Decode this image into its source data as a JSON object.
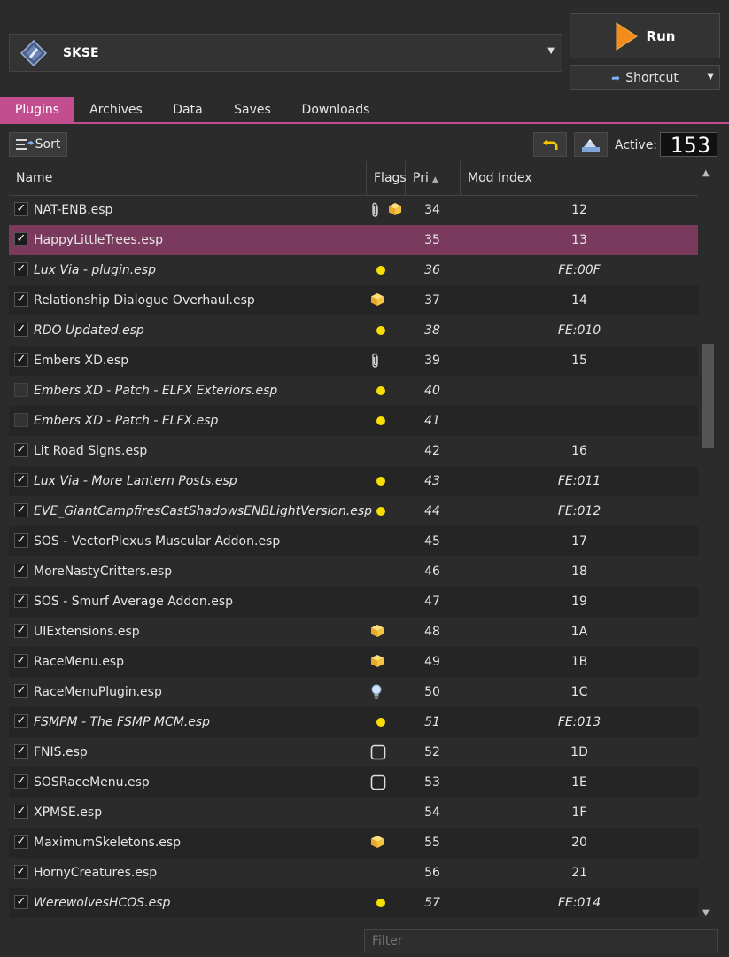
{
  "executable": {
    "selected": "SKSE"
  },
  "run": {
    "label": "Run"
  },
  "shortcut": {
    "label": "Shortcut"
  },
  "tabs": [
    "Plugins",
    "Archives",
    "Data",
    "Saves",
    "Downloads"
  ],
  "toolbar": {
    "sort_label": "Sort",
    "active_label": "Active:",
    "active_count": "153"
  },
  "columns": {
    "name": "Name",
    "flags": "Flags",
    "priority": "Pri",
    "mod_index": "Mod Index"
  },
  "filter": {
    "placeholder": "Filter"
  },
  "colors": {
    "accent": "#c24d8f",
    "selected_row": "#7a3a5e",
    "light_dot": "#f7df00"
  },
  "plugins": [
    {
      "name": "NAT-ENB.esp",
      "checked": true,
      "flags": [
        "paperclip",
        "package"
      ],
      "priority": "34",
      "mod_index": "12",
      "light": false
    },
    {
      "name": "HappyLittleTrees.esp",
      "checked": true,
      "flags": [],
      "priority": "35",
      "mod_index": "13",
      "light": false,
      "selected": true
    },
    {
      "name": "Lux Via - plugin.esp",
      "checked": true,
      "flags": [
        "light-dot"
      ],
      "priority": "36",
      "mod_index": "FE:00F",
      "light": true
    },
    {
      "name": "Relationship Dialogue Overhaul.esp",
      "checked": true,
      "flags": [
        "package"
      ],
      "priority": "37",
      "mod_index": "14",
      "light": false
    },
    {
      "name": "RDO Updated.esp",
      "checked": true,
      "flags": [
        "light-dot"
      ],
      "priority": "38",
      "mod_index": "FE:010",
      "light": true
    },
    {
      "name": "Embers XD.esp",
      "checked": true,
      "flags": [
        "paperclip"
      ],
      "priority": "39",
      "mod_index": "15",
      "light": false
    },
    {
      "name": "Embers XD - Patch - ELFX Exteriors.esp",
      "checked": false,
      "flags": [
        "light-dot"
      ],
      "priority": "40",
      "mod_index": "",
      "light": true
    },
    {
      "name": "Embers XD - Patch - ELFX.esp",
      "checked": false,
      "flags": [
        "light-dot"
      ],
      "priority": "41",
      "mod_index": "",
      "light": true
    },
    {
      "name": "Lit Road Signs.esp",
      "checked": true,
      "flags": [],
      "priority": "42",
      "mod_index": "16",
      "light": false
    },
    {
      "name": "Lux Via - More Lantern Posts.esp",
      "checked": true,
      "flags": [
        "light-dot"
      ],
      "priority": "43",
      "mod_index": "FE:011",
      "light": true
    },
    {
      "name": "EVE_GiantCampfiresCastShadowsENBLightVersion.esp",
      "checked": true,
      "flags": [
        "light-dot"
      ],
      "priority": "44",
      "mod_index": "FE:012",
      "light": true
    },
    {
      "name": "SOS - VectorPlexus Muscular Addon.esp",
      "checked": true,
      "flags": [],
      "priority": "45",
      "mod_index": "17",
      "light": false
    },
    {
      "name": "MoreNastyCritters.esp",
      "checked": true,
      "flags": [],
      "priority": "46",
      "mod_index": "18",
      "light": false
    },
    {
      "name": "SOS - Smurf Average Addon.esp",
      "checked": true,
      "flags": [],
      "priority": "47",
      "mod_index": "19",
      "light": false
    },
    {
      "name": "UIExtensions.esp",
      "checked": true,
      "flags": [
        "package"
      ],
      "priority": "48",
      "mod_index": "1A",
      "light": false
    },
    {
      "name": "RaceMenu.esp",
      "checked": true,
      "flags": [
        "package"
      ],
      "priority": "49",
      "mod_index": "1B",
      "light": false
    },
    {
      "name": "RaceMenuPlugin.esp",
      "checked": true,
      "flags": [
        "lightbulb"
      ],
      "priority": "50",
      "mod_index": "1C",
      "light": false
    },
    {
      "name": "FSMPM - The FSMP MCM.esp",
      "checked": true,
      "flags": [
        "light-dot"
      ],
      "priority": "51",
      "mod_index": "FE:013",
      "light": true
    },
    {
      "name": "FNIS.esp",
      "checked": true,
      "flags": [
        "square"
      ],
      "priority": "52",
      "mod_index": "1D",
      "light": false
    },
    {
      "name": "SOSRaceMenu.esp",
      "checked": true,
      "flags": [
        "square"
      ],
      "priority": "53",
      "mod_index": "1E",
      "light": false
    },
    {
      "name": "XPMSE.esp",
      "checked": true,
      "flags": [],
      "priority": "54",
      "mod_index": "1F",
      "light": false
    },
    {
      "name": "MaximumSkeletons.esp",
      "checked": true,
      "flags": [
        "package"
      ],
      "priority": "55",
      "mod_index": "20",
      "light": false
    },
    {
      "name": "HornyCreatures.esp",
      "checked": true,
      "flags": [],
      "priority": "56",
      "mod_index": "21",
      "light": false
    },
    {
      "name": "WerewolvesHCOS.esp",
      "checked": true,
      "flags": [
        "light-dot"
      ],
      "priority": "57",
      "mod_index": "FE:014",
      "light": true
    }
  ]
}
